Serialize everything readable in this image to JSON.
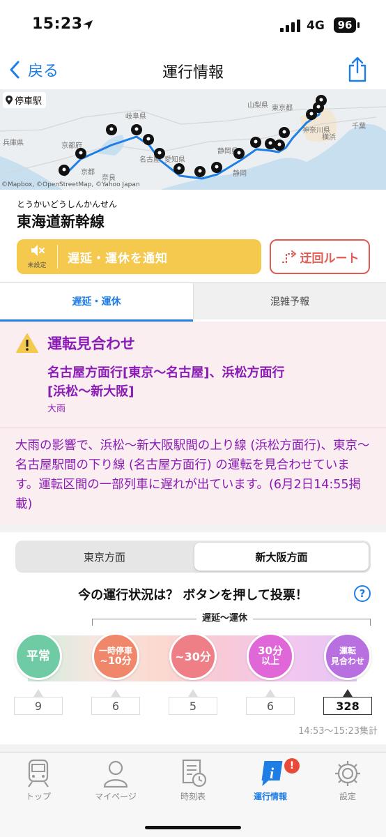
{
  "status_bar": {
    "time": "15:23",
    "network": "4G",
    "battery": "96"
  },
  "nav": {
    "back_label": "戻る",
    "title": "運行情報"
  },
  "map": {
    "stop_chip": "停車駅",
    "credit": "©Mapbox, ©OpenStreetMap, ©Yahoo Japan",
    "labels": {
      "yamanashi": "山梨県",
      "tokyo": "東京都",
      "chiba": "千葉",
      "hyogo": "兵庫県",
      "kyoto": "京都府",
      "gifu": "岐阜県",
      "aichi": "愛知県",
      "shizuoka": "静岡県",
      "kanagawa": "神奈川県",
      "nagoya": "名古屋",
      "shizuoka_st": "静岡",
      "yokohama": "横浜",
      "kyoto_st": "京都",
      "nara": "奈良"
    }
  },
  "line": {
    "furigana": "とうかいどうしんかんせん",
    "name": "東海道新幹線",
    "notify_sub": "未設定",
    "notify_label": "遅延・運休を通知",
    "detour_label": "迂回ルート"
  },
  "tabs": {
    "delay": "遅延・運休",
    "crowd": "混雑予報"
  },
  "alert": {
    "title": "運転見合わせ",
    "sections_line1": "名古屋方面行[東京〜名古屋]、浜松方面行",
    "sections_line2": "[浜松〜新大阪]",
    "cause": "大雨",
    "detail": "大雨の影響で、浜松〜新大阪駅間の上り線 (浜松方面行)、東京〜名古屋駅間の下り線 (名古屋方面行) の運転を見合わせています。運転区間の一部列車に遅れが出ています。(6月2日14:55掲載)"
  },
  "vote": {
    "direction_left": "東京方面",
    "direction_right": "新大阪方面",
    "title": "今の運行状況は？ ボタンを押して投票！",
    "help": "?",
    "bracket_label": "遅延〜運休",
    "options": [
      {
        "line1": "平常",
        "line2": "",
        "count": "9"
      },
      {
        "line1": "一時停車",
        "line2": "~10分",
        "count": "6"
      },
      {
        "line1": "~30分",
        "line2": "",
        "count": "5"
      },
      {
        "line1": "30分",
        "line2": "以上",
        "count": "6"
      },
      {
        "line1": "運転",
        "line2": "見合わせ",
        "count": "328"
      }
    ],
    "period": "14:53〜15:23集計"
  },
  "tabbar": {
    "top": "トップ",
    "mypage": "マイページ",
    "timetable": "時刻表",
    "info": "運行情報",
    "settings": "設定",
    "badge": "!"
  },
  "colors": {
    "accent": "#1e7ee6",
    "alert_purple": "#8b1bb5",
    "notify_yellow": "#f5c94d",
    "detour_red": "#e25a51",
    "badge_red": "#e84a3a"
  }
}
